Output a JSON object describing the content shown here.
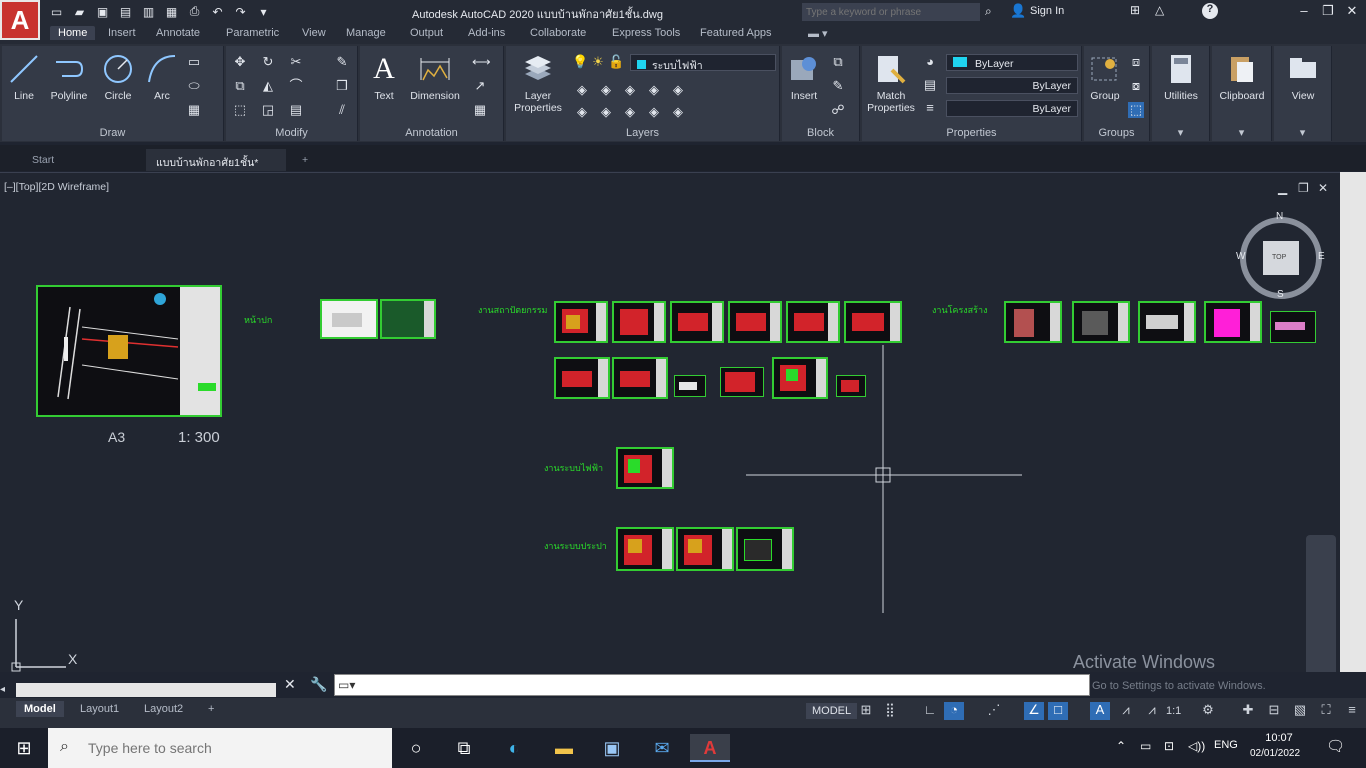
{
  "app": {
    "logo_letter": "A",
    "window_title": "Autodesk AutoCAD 2020   แบบบ้านพักอาศัย1ชั้น.dwg",
    "search_placeholder": "Type a keyword or phrase",
    "sign_in": "Sign In"
  },
  "ribbon_tabs": [
    "Home",
    "Insert",
    "Annotate",
    "Parametric",
    "View",
    "Manage",
    "Output",
    "Add-ins",
    "Collaborate",
    "Express Tools",
    "Featured Apps"
  ],
  "ribbon": {
    "draw": {
      "title": "Draw",
      "tools": [
        "Line",
        "Polyline",
        "Circle",
        "Arc"
      ]
    },
    "modify": {
      "title": "Modify"
    },
    "annotation": {
      "title": "Annotation",
      "tools": [
        "Text",
        "Dimension"
      ]
    },
    "layers": {
      "title": "Layers",
      "layer_properties": "Layer Properties",
      "current_layer": "ระบบไฟฟ้า"
    },
    "block": {
      "title": "Block",
      "insert": "Insert"
    },
    "properties": {
      "title": "Properties",
      "match": "Match Properties",
      "color": "ByLayer",
      "linetype": "ByLayer",
      "lineweight": "ByLayer"
    },
    "groups": {
      "title": "Groups",
      "group": "Group"
    },
    "utilities": "Utilities",
    "clipboard": "Clipboard",
    "view": "View"
  },
  "doc_tabs": [
    "Start",
    "แบบบ้านพักอาศัย1ชั้น*"
  ],
  "viewport": {
    "label": "[–][Top][2D Wireframe]",
    "paper_size": "A3",
    "scale": "1: 300",
    "group_labels": [
      "หน้าปก",
      "งานสถาปัตยกรรม",
      "งานโครงสร้าง",
      "งานระบบไฟฟ้า",
      "งานระบบประปา"
    ],
    "compass": {
      "n": "N",
      "s": "S",
      "e": "E",
      "w": "W",
      "top": "TOP"
    },
    "ucs_y": "Y",
    "ucs_x": "X"
  },
  "command_line": {
    "prompt": ""
  },
  "watermark": {
    "title": "Activate Windows",
    "subtitle": "Go to Settings to activate Windows."
  },
  "layout_tabs": [
    "Model",
    "Layout1",
    "Layout2"
  ],
  "status": {
    "model": "MODEL",
    "annoscale": "1:1"
  },
  "taskbar": {
    "search_placeholder": "Type here to search",
    "lang": "ENG",
    "time": "10:07",
    "date": "02/01/2022"
  }
}
